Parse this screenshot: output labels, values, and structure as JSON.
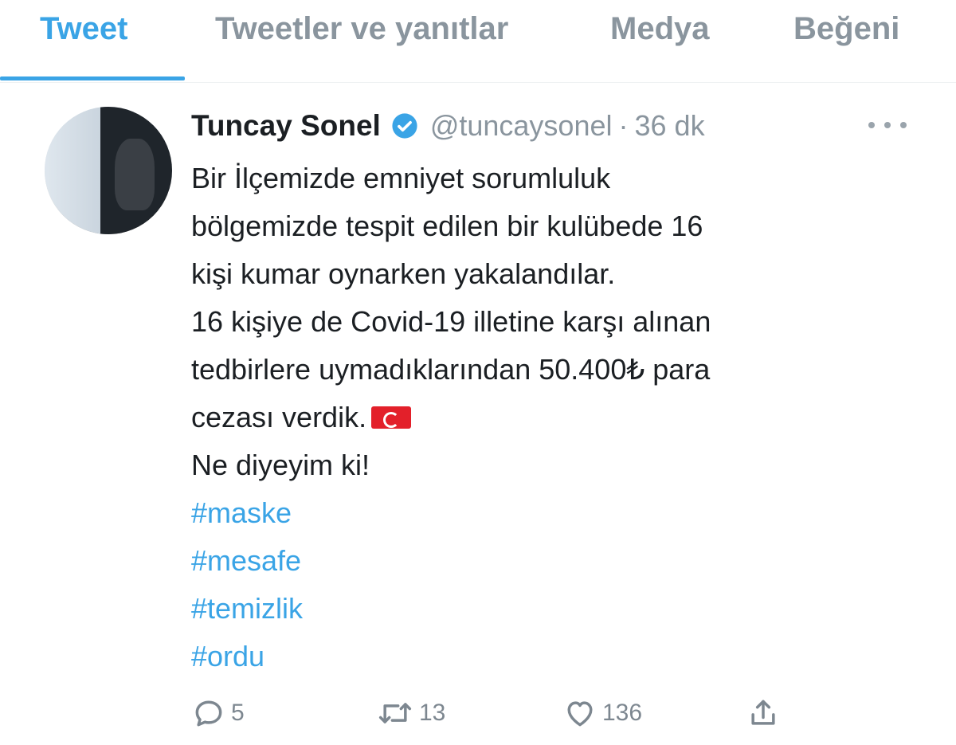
{
  "tabs": [
    {
      "label": "Tweet",
      "active": true
    },
    {
      "label": "Tweetler ve yanıtlar",
      "active": false
    },
    {
      "label": "Medya",
      "active": false
    },
    {
      "label": "Beğeni",
      "active": false
    }
  ],
  "tweet": {
    "display_name": "Tuncay Sonel",
    "handle": "@tuncaysonel",
    "separator": "·",
    "time": "36 dk",
    "lines": [
      "Bir İlçemizde emniyet sorumluluk",
      "bölgemizde tespit edilen bir kulübede 16",
      "kişi kumar oynarken yakalandılar.",
      "16 kişiye de Covid-19 illetine karşı alınan",
      "tedbirlere uymadıklarından 50.400₺ para",
      "cezası verdik.",
      "Ne diyeyim ki!"
    ],
    "hashtags": [
      "#maske",
      "#mesafe",
      "#temizlik",
      "#ordu"
    ],
    "counts": {
      "replies": "5",
      "retweets": "13",
      "likes": "136"
    }
  },
  "colors": {
    "accent": "#3aa4e6",
    "muted": "#8a959e",
    "flag": "#e3202a"
  },
  "icons": [
    "verified-badge-icon",
    "more-icon",
    "reply-icon",
    "retweet-icon",
    "like-icon",
    "share-icon",
    "turkey-flag-icon"
  ]
}
